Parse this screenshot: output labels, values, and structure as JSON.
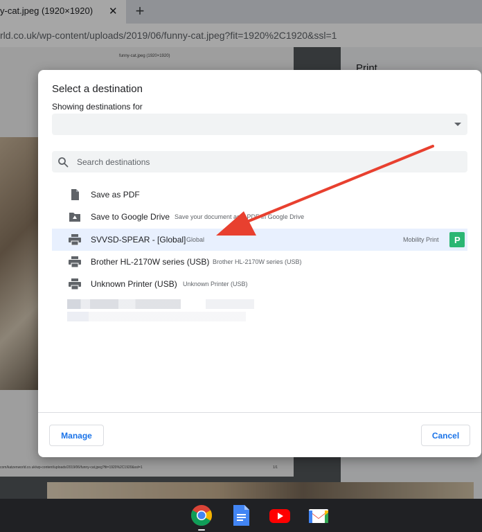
{
  "browser": {
    "tab_title": "y-cat.jpeg (1920×1920)",
    "tab_close": "✕",
    "new_tab": "+",
    "url": "rld.co.uk/wp-content/uploads/2019/06/funny-cat.jpeg?fit=1920%2C1920&ssl=1"
  },
  "preview": {
    "page_header": "funny-cat.jpeg (1920×1920)",
    "page_footer": "com/katzenworld.co.uk/wp-content/uploads/2019/06/funny-cat.jpeg?fit=1920%2C1920&ssl=1",
    "page_number": "1/1",
    "panel_title": "Print"
  },
  "dialog": {
    "title": "Select a destination",
    "subtitle": "Showing destinations for",
    "dropdown_value": "",
    "search_placeholder": "Search destinations",
    "destinations": [
      {
        "name": "Save as PDF",
        "description": "",
        "extension": "",
        "icon": "document-icon"
      },
      {
        "name": "Save to Google Drive",
        "description": "Save your document as a PDF in Google Drive",
        "extension": "",
        "icon": "drive-icon"
      },
      {
        "name": "SVVSD-SPEAR - [Global]",
        "description": "Global",
        "extension": "Mobility Print",
        "icon": "printer-icon"
      },
      {
        "name": "Brother HL-2170W series (USB)",
        "description": "Brother HL-2170W series (USB)",
        "extension": "",
        "icon": "printer-icon"
      },
      {
        "name": "Unknown Printer (USB)",
        "description": "Unknown Printer (USB)",
        "extension": "",
        "icon": "printer-icon"
      }
    ],
    "selected_index": 2,
    "manage_label": "Manage",
    "cancel_label": "Cancel"
  },
  "colors": {
    "accent": "#1a73e8",
    "selected_row": "#e8f0fe",
    "arrow": "#e8402f",
    "mobility_print_badge": "#2bb673"
  },
  "shelf": {
    "apps": [
      "chrome-icon",
      "docs-icon",
      "youtube-icon",
      "gmail-icon"
    ]
  }
}
